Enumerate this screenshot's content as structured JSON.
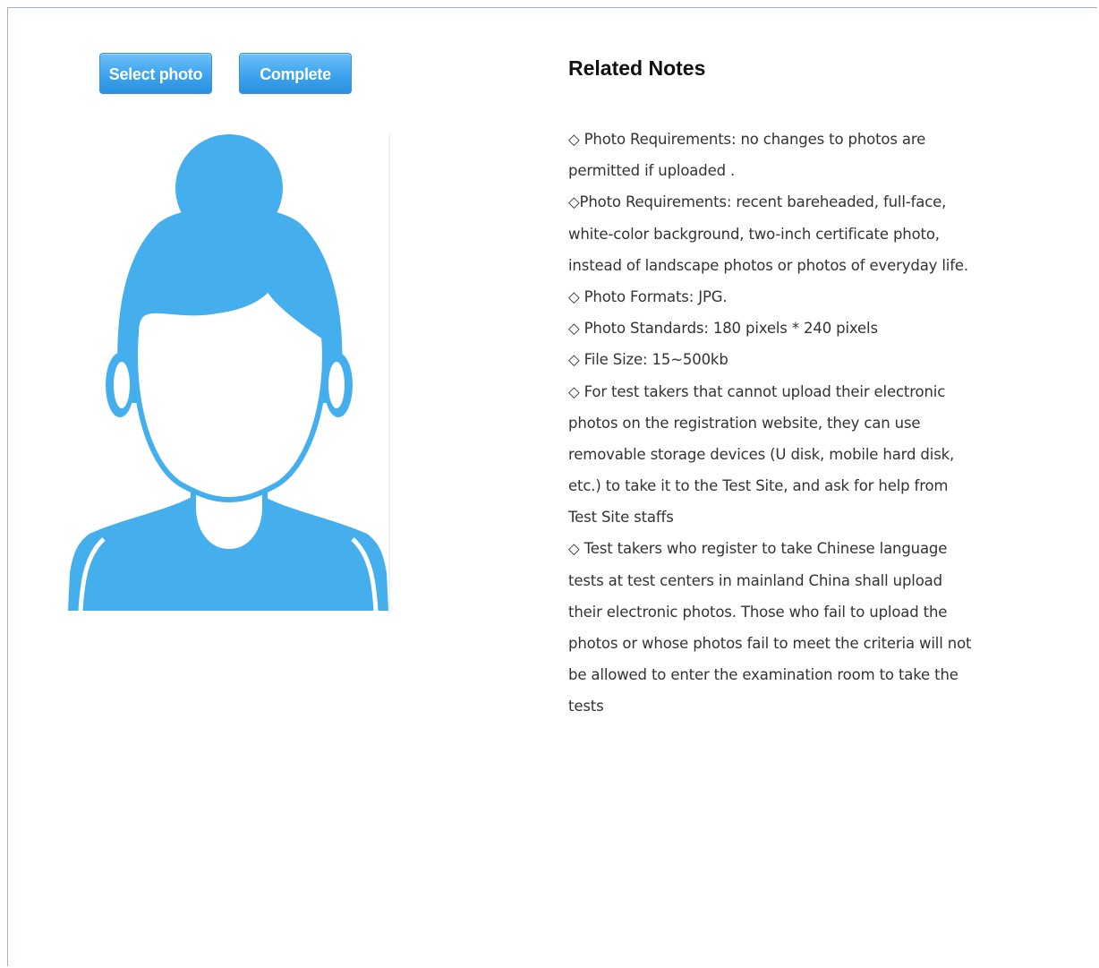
{
  "buttons": {
    "select_photo": "Select photo",
    "complete": "Complete"
  },
  "avatar": {
    "icon": "female-avatar-placeholder-icon",
    "color": "#45aeec"
  },
  "notes": {
    "title": "Related Notes",
    "lines": [
      "◇ Photo Requirements: no changes to photos are",
      "permitted if uploaded .",
      "◇Photo Requirements: recent bareheaded, full-face,",
      "white-color background, two-inch certificate photo,",
      "instead of landscape photos or photos of everyday life.",
      "◇ Photo Formats: JPG.",
      "◇ Photo Standards: 180 pixels * 240 pixels",
      "◇ File Size: 15~500kb",
      "◇ For test takers that cannot upload their electronic",
      "photos on the registration website, they can use",
      "removable storage devices (U disk, mobile hard disk,",
      "etc.) to take it to the Test Site, and ask for help from",
      "Test Site staffs",
      "◇ Test takers who register to take Chinese language",
      "tests at test centers in mainland China shall upload",
      "their electronic photos. Those who fail to upload the",
      "photos or whose photos fail to meet the criteria will not",
      "be allowed to enter the examination room to take the",
      "tests"
    ]
  }
}
